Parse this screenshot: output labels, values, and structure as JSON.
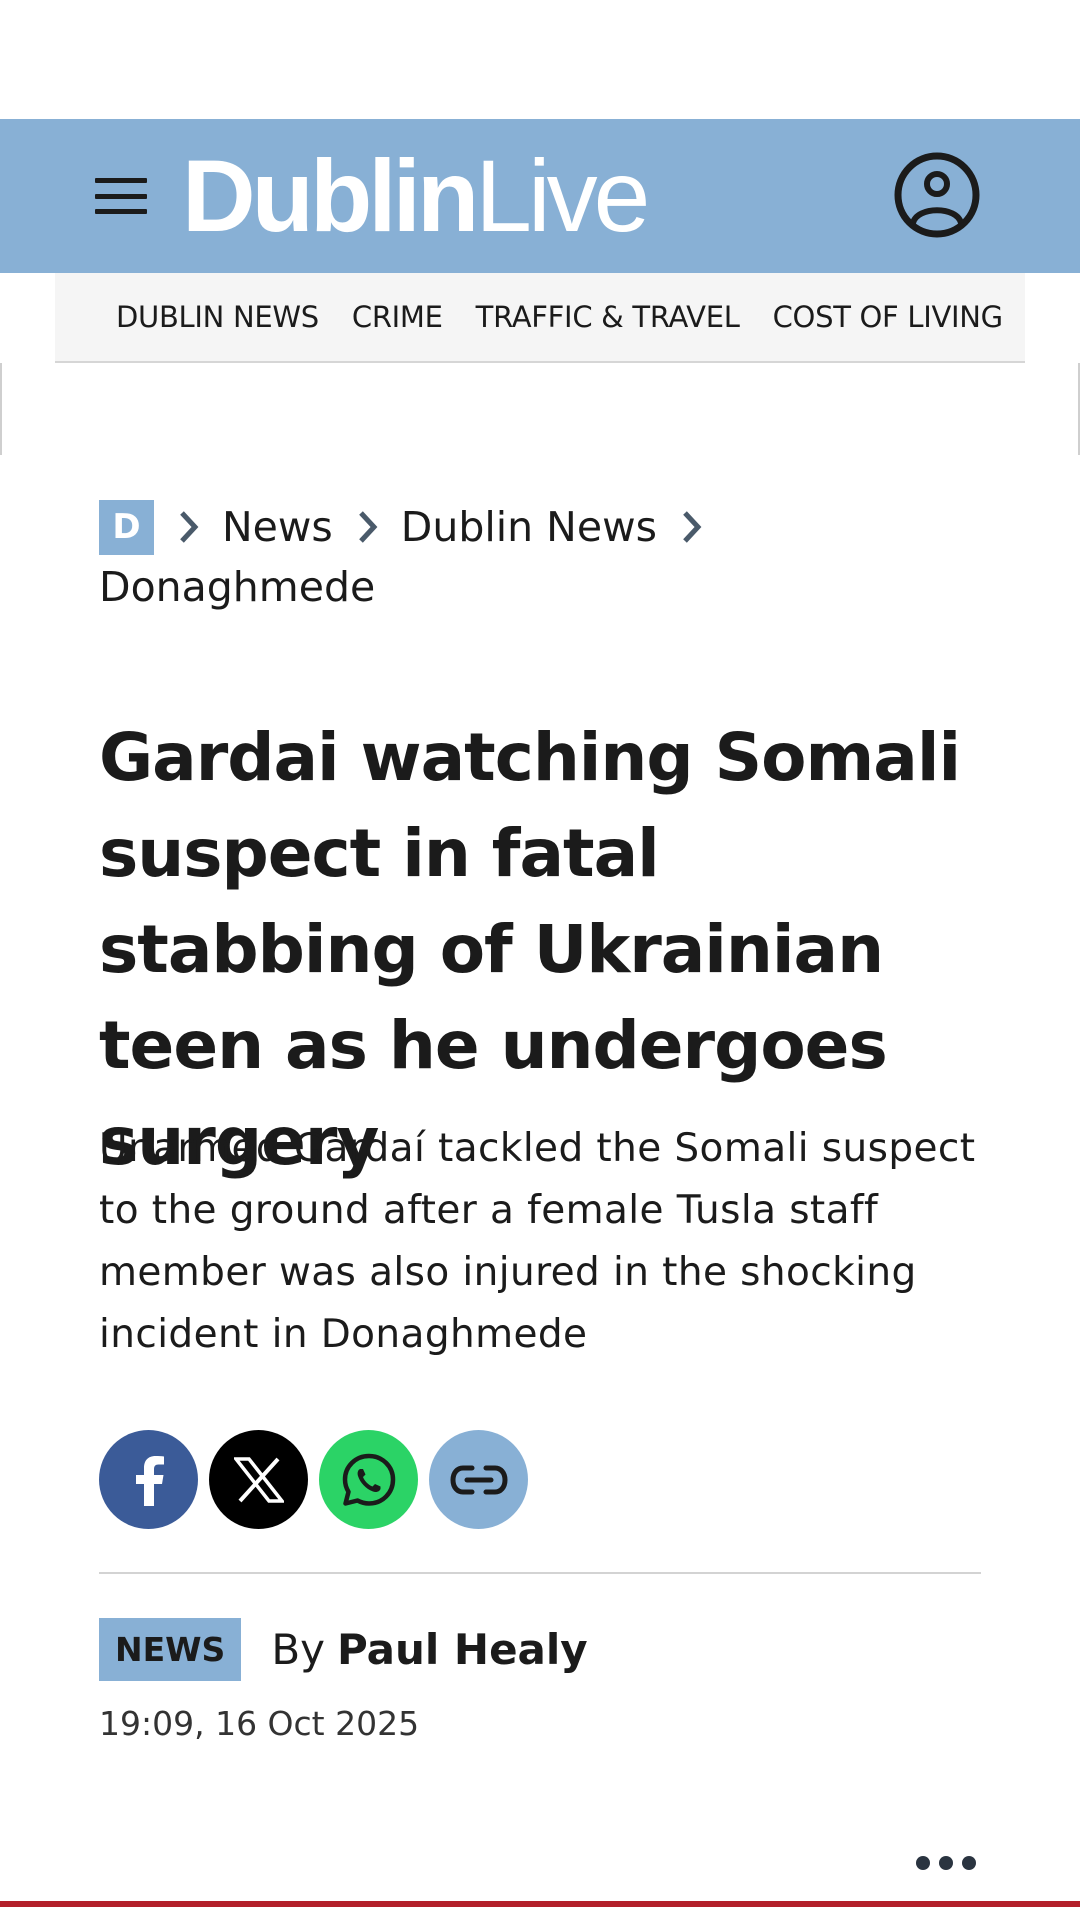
{
  "header": {
    "logo_bold": "Dublin",
    "logo_light": "Live",
    "colors": {
      "header_bg": "#88b0d5",
      "logo": "#ffffff"
    },
    "icons": {
      "menu": "hamburger-menu-icon",
      "account": "user-account-icon"
    }
  },
  "nav": {
    "items": [
      "DUBLIN NEWS",
      "CRIME",
      "TRAFFIC & TRAVEL",
      "COST OF LIVING"
    ]
  },
  "breadcrumb": {
    "home_letter": "D",
    "items": [
      "News",
      "Dublin News",
      "Donaghmede"
    ]
  },
  "article": {
    "headline": "Gardai watching Somali suspect in fatal stabbing of Ukrainian teen as he undergoes surgery",
    "standfirst": "Unarmed Gardaí tackled the Somali suspect to the ground after a female Tusla staff member was also injured in the shocking incident in Donaghmede",
    "category_tag": "NEWS",
    "by_prefix": "By",
    "author": "Paul Healy",
    "timestamp": "19:09, 16 Oct 2025"
  },
  "share": {
    "buttons": [
      {
        "icon": "facebook-icon",
        "color": "#3b5b98"
      },
      {
        "icon": "x-icon",
        "color": "#000000"
      },
      {
        "icon": "whatsapp-icon",
        "color": "#2bd366"
      },
      {
        "icon": "copy-link-icon",
        "color": "#88b0d5"
      }
    ]
  },
  "footer": {
    "icon": "more-options-icon",
    "bar_color": "#b3202a"
  }
}
